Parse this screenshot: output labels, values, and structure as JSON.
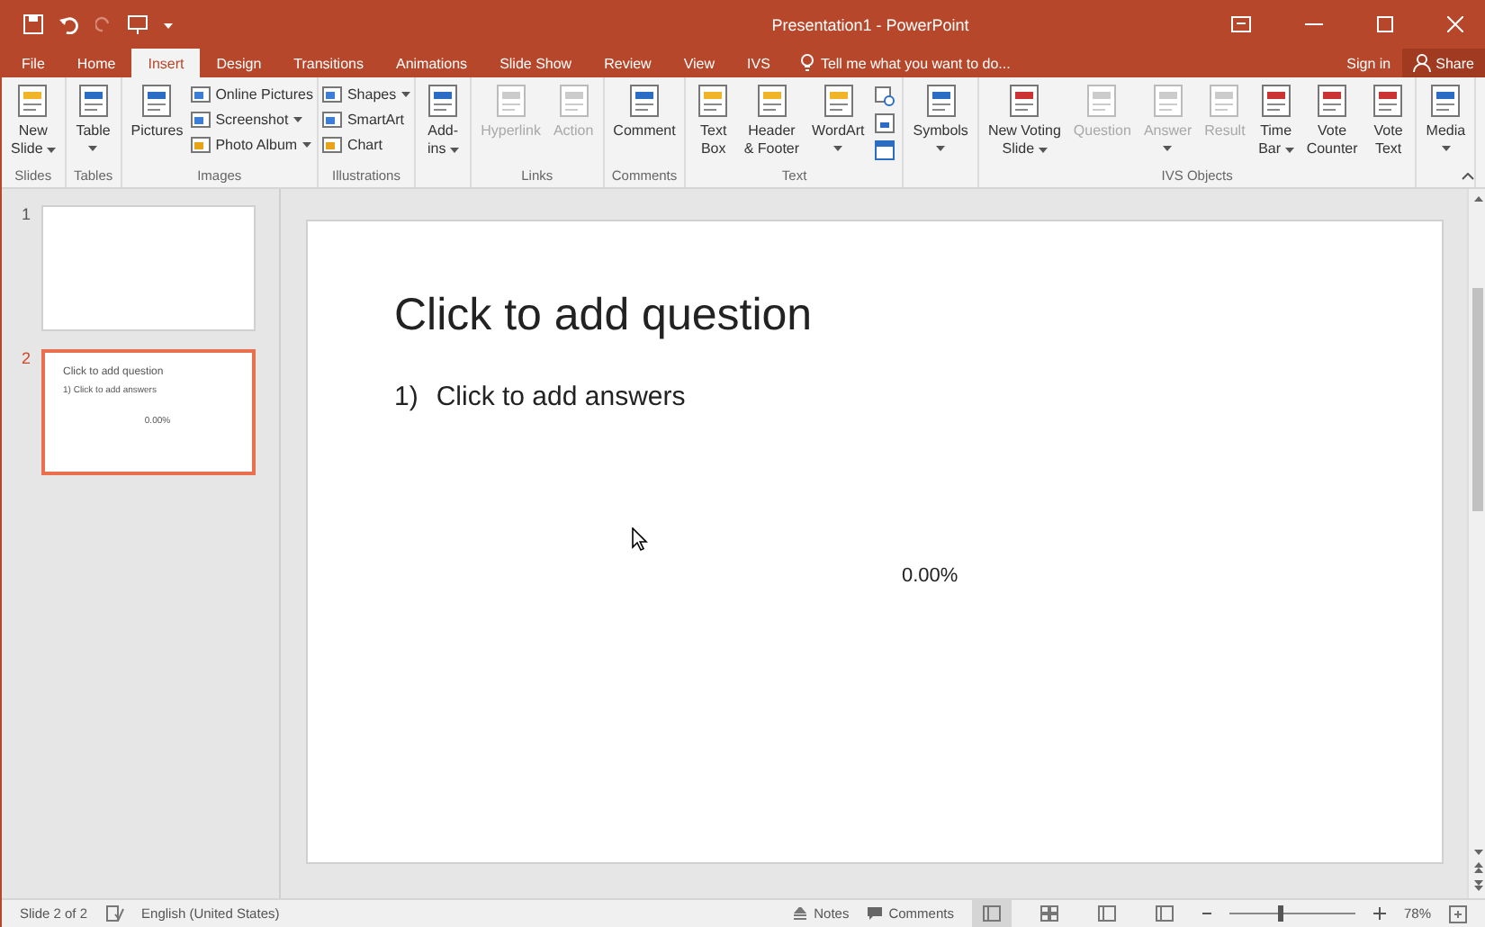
{
  "window": {
    "title": "Presentation1 - PowerPoint"
  },
  "tabs": [
    {
      "label": "File",
      "selected": false
    },
    {
      "label": "Home",
      "selected": false
    },
    {
      "label": "Insert",
      "selected": true
    },
    {
      "label": "Design",
      "selected": false
    },
    {
      "label": "Transitions",
      "selected": false
    },
    {
      "label": "Animations",
      "selected": false
    },
    {
      "label": "Slide Show",
      "selected": false
    },
    {
      "label": "Review",
      "selected": false
    },
    {
      "label": "View",
      "selected": false
    },
    {
      "label": "IVS",
      "selected": false
    }
  ],
  "tell_me": {
    "placeholder": "Tell me what you want to do..."
  },
  "account": {
    "sign_in": "Sign in",
    "share": "Share"
  },
  "ribbon": {
    "groups": [
      {
        "label": "Slides",
        "items": [
          {
            "kind": "large",
            "lines": [
              "New",
              "Slide"
            ],
            "dropdown": true,
            "disabled": false
          }
        ]
      },
      {
        "label": "Tables",
        "items": [
          {
            "kind": "large",
            "lines": [
              "Table"
            ],
            "dropdown": true,
            "disabled": false
          }
        ]
      },
      {
        "label": "Images",
        "items": [
          {
            "kind": "large",
            "lines": [
              "Pictures"
            ],
            "dropdown": false,
            "disabled": false
          },
          {
            "kind": "stack",
            "entries": [
              {
                "label": "Online Pictures",
                "dropdown": false
              },
              {
                "label": "Screenshot",
                "dropdown": true
              },
              {
                "label": "Photo Album",
                "dropdown": true
              }
            ]
          }
        ]
      },
      {
        "label": "Illustrations",
        "items": [
          {
            "kind": "stack",
            "entries": [
              {
                "label": "Shapes",
                "dropdown": true
              },
              {
                "label": "SmartArt",
                "dropdown": false
              },
              {
                "label": "Chart",
                "dropdown": false
              }
            ]
          }
        ]
      },
      {
        "items": [
          {
            "kind": "large",
            "lines": [
              "Add-",
              "ins"
            ],
            "dropdown": true,
            "disabled": false
          }
        ]
      },
      {
        "label": "Links",
        "items": [
          {
            "kind": "large",
            "lines": [
              "Hyperlink"
            ],
            "dropdown": false,
            "disabled": true
          },
          {
            "kind": "large",
            "lines": [
              "Action"
            ],
            "dropdown": false,
            "disabled": true
          }
        ]
      },
      {
        "label": "Comments",
        "items": [
          {
            "kind": "large",
            "lines": [
              "Comment"
            ],
            "dropdown": false,
            "disabled": false
          }
        ]
      },
      {
        "label": "Text",
        "items": [
          {
            "kind": "large",
            "lines": [
              "Text",
              "Box"
            ],
            "dropdown": false,
            "disabled": false
          },
          {
            "kind": "large",
            "lines": [
              "Header",
              "& Footer"
            ],
            "dropdown": false,
            "disabled": false
          },
          {
            "kind": "large",
            "lines": [
              "WordArt"
            ],
            "dropdown": true,
            "disabled": false
          },
          {
            "kind": "icons"
          }
        ]
      },
      {
        "items": [
          {
            "kind": "large",
            "lines": [
              "Symbols"
            ],
            "dropdown": true,
            "disabled": false
          }
        ]
      },
      {
        "label": "IVS Objects",
        "items": [
          {
            "kind": "large",
            "lines": [
              "New Voting",
              "Slide"
            ],
            "dropdown": true,
            "disabled": false
          },
          {
            "kind": "large",
            "lines": [
              "Question"
            ],
            "dropdown": false,
            "disabled": true
          },
          {
            "kind": "large",
            "lines": [
              "Answer"
            ],
            "dropdown": true,
            "disabled": true
          },
          {
            "kind": "large",
            "lines": [
              "Result"
            ],
            "dropdown": false,
            "disabled": true
          },
          {
            "kind": "large",
            "lines": [
              "Time",
              "Bar"
            ],
            "dropdown": true,
            "disabled": false
          },
          {
            "kind": "large",
            "lines": [
              "Vote",
              "Counter"
            ],
            "dropdown": false,
            "disabled": false
          },
          {
            "kind": "large",
            "lines": [
              "Vote",
              "Text"
            ],
            "dropdown": false,
            "disabled": false
          }
        ]
      },
      {
        "items": [
          {
            "kind": "large",
            "lines": [
              "Media"
            ],
            "dropdown": true,
            "disabled": false
          }
        ]
      }
    ]
  },
  "thumbnails": [
    {
      "number": "1",
      "selected": false
    },
    {
      "number": "2",
      "selected": true,
      "title": "Click to add question",
      "answer": "1)  Click to add answers",
      "result": "0.00%"
    }
  ],
  "slide": {
    "title": "Click to add question",
    "answers": [
      {
        "number": "1)",
        "text": "Click to add answers"
      }
    ],
    "result": "0.00%"
  },
  "status_bar": {
    "slide": "Slide 2 of 2",
    "language": "English (United States)",
    "notes": "Notes",
    "comments": "Comments",
    "views": [
      {
        "selected": true
      },
      {
        "selected": false
      },
      {
        "selected": false
      },
      {
        "selected": false
      }
    ],
    "zoom": {
      "level": 0.4,
      "reading": "78%"
    }
  }
}
